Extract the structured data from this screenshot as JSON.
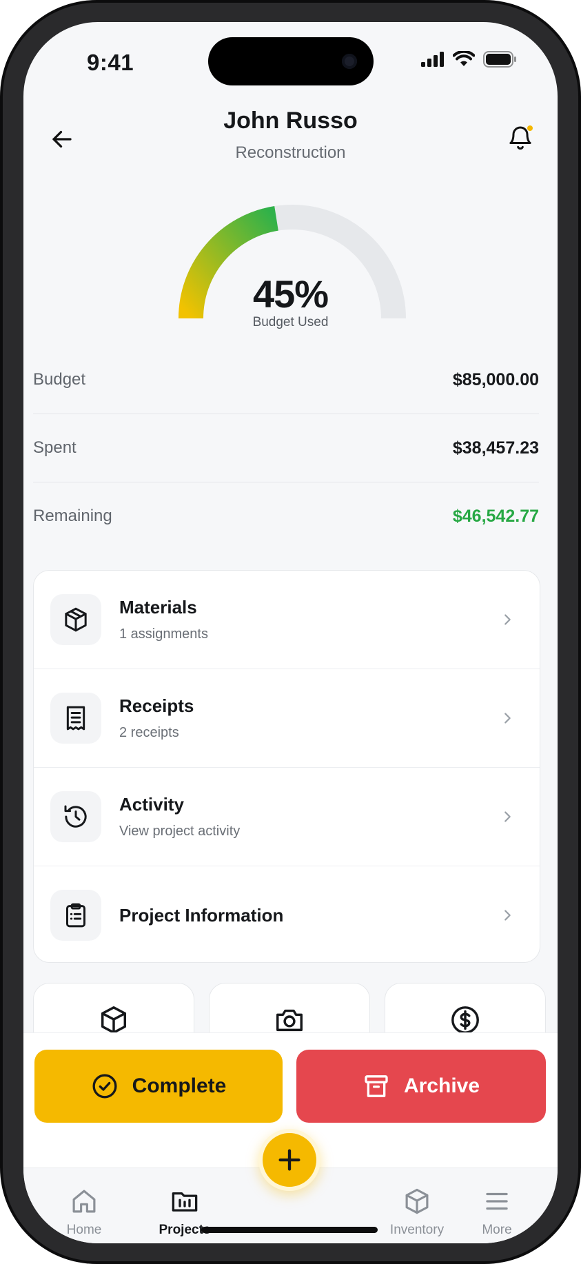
{
  "status_bar": {
    "time": "9:41"
  },
  "header": {
    "title": "John Russo",
    "subtitle": "Reconstruction"
  },
  "gauge": {
    "percent_text": "45%",
    "label": "Budget Used",
    "fill_fraction": 0.45,
    "colors": {
      "start": "#f2c200",
      "end": "#2fb14a",
      "track": "#e6e8eb"
    }
  },
  "budget": {
    "rows": [
      {
        "label": "Budget",
        "value": "$85,000.00"
      },
      {
        "label": "Spent",
        "value": "$38,457.23"
      },
      {
        "label": "Remaining",
        "value": "$46,542.77"
      }
    ],
    "remaining_color": "#27a844"
  },
  "menu": {
    "items": [
      {
        "icon": "package-icon",
        "title": "Materials",
        "subtitle": "1 assignments"
      },
      {
        "icon": "receipt-icon",
        "title": "Receipts",
        "subtitle": "2 receipts"
      },
      {
        "icon": "history-icon",
        "title": "Activity",
        "subtitle": "View project activity"
      },
      {
        "icon": "clipboard-icon",
        "title": "Project Information",
        "subtitle": ""
      }
    ]
  },
  "quick_actions": {
    "icons": [
      "package-icon",
      "camera-icon",
      "dollar-icon"
    ]
  },
  "actions": {
    "complete_label": "Complete",
    "archive_label": "Archive",
    "complete_color": "#f5b900",
    "archive_color": "#e5474e"
  },
  "tabbar": {
    "tabs": [
      {
        "label": "Home",
        "icon": "home-icon",
        "active": false
      },
      {
        "label": "Projects",
        "icon": "folder-icon",
        "active": true
      },
      {
        "label": "Inventory",
        "icon": "package-icon",
        "active": false
      },
      {
        "label": "More",
        "icon": "menu-icon",
        "active": false
      }
    ],
    "fab_icon": "plus-icon"
  }
}
